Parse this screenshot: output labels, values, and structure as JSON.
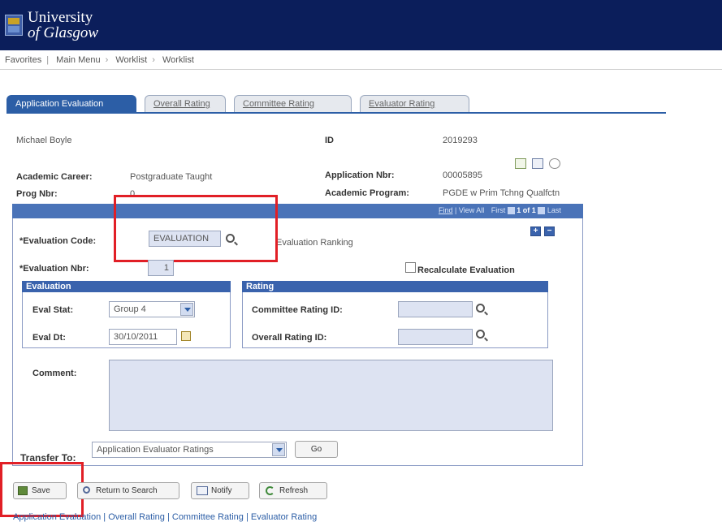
{
  "header": {
    "logo_line1": "University",
    "logo_line2": "of Glasgow"
  },
  "breadcrumb": [
    "Favorites",
    "Main Menu",
    "Worklist",
    "Worklist"
  ],
  "tabs": [
    "Application Evaluation",
    "Overall Rating",
    "Committee Rating",
    "Evaluator Rating"
  ],
  "applicant": {
    "name": "Michael Boyle",
    "id_label": "ID",
    "id_value": "2019293",
    "academic_career_label": "Academic Career:",
    "academic_career_value": "Postgraduate Taught",
    "application_nbr_label": "Application Nbr:",
    "application_nbr_value": "00005895",
    "prog_nbr_label": "Prog Nbr:",
    "prog_nbr_value": "0",
    "academic_program_label": "Academic Program:",
    "academic_program_value": "PGDE w Prim Tchng Qualfctn"
  },
  "navbar": {
    "find": "Find",
    "view_all": "View All",
    "first": "First",
    "count": "1 of 1",
    "last": "Last"
  },
  "evaluation": {
    "code_label": "*Evaluation Code:",
    "code_value": "EVALUATION",
    "code_desc": "Evaluation Ranking",
    "nbr_label": "*Evaluation Nbr:",
    "nbr_value": "1",
    "recalc_label": "Recalculate Evaluation",
    "section_eval": "Evaluation",
    "eval_stat_label": "Eval Stat:",
    "eval_stat_value": "Group 4",
    "eval_dt_label": "Eval Dt:",
    "eval_dt_value": "30/10/2011",
    "section_rating": "Rating",
    "committee_label": "Committee Rating ID:",
    "overall_label": "Overall Rating ID:",
    "comment_label": "Comment:"
  },
  "transfer": {
    "label": "Transfer To:",
    "value": "Application Evaluator Ratings",
    "go": "Go"
  },
  "buttons": {
    "save": "Save",
    "return": "Return to Search",
    "notify": "Notify",
    "refresh": "Refresh"
  },
  "footer": "Application Evaluation | Overall Rating | Committee Rating | Evaluator Rating"
}
